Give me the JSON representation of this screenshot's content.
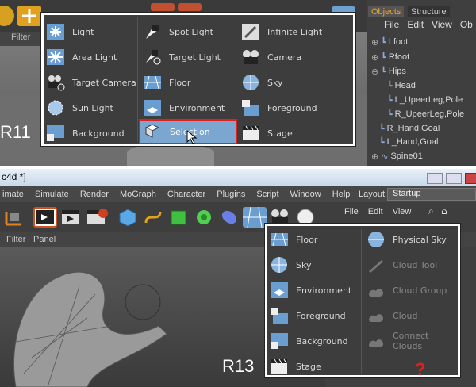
{
  "r11": {
    "label": "R11",
    "sub_toolbar": "Filter",
    "objects_panel": {
      "tabs": [
        "Objects",
        "Structure"
      ],
      "menu": [
        "File",
        "Edit",
        "View",
        "Ob"
      ],
      "tree": [
        "Lfoot",
        "Rfoot",
        "Hips",
        "Head",
        "L_UpeerLeg,Pole",
        "R_UpeerLeg,Pole",
        "R_Hand,Goal",
        "L_Hand,Goal",
        "Spine01"
      ]
    },
    "menu": [
      [
        "Light",
        "Spot Light",
        "Infinite Light"
      ],
      [
        "Area Light",
        "Target Light",
        "Camera"
      ],
      [
        "Target Camera",
        "Floor",
        "Sky"
      ],
      [
        "Sun Light",
        "Environment",
        "Foreground"
      ],
      [
        "Background",
        "Selection",
        "Stage"
      ]
    ],
    "highlighted": "Selection"
  },
  "r13": {
    "label": "R13",
    "title": "c4d *]",
    "menubar": [
      "imate",
      "Simulate",
      "Render",
      "MoGraph",
      "Character",
      "Plugins",
      "Script",
      "Window",
      "Help"
    ],
    "layout_label": "Layout:",
    "layout_value": "Startup",
    "sub_toolbar": [
      "Filter",
      "Panel"
    ],
    "obj_menu": [
      "File",
      "Edit",
      "View"
    ],
    "menu_left": [
      "Floor",
      "Sky",
      "Environment",
      "Foreground",
      "Background",
      "Stage"
    ],
    "menu_right": [
      "Physical Sky",
      "Cloud Tool",
      "Cloud Group",
      "Cloud",
      "Connect Clouds"
    ],
    "question_mark": "?"
  },
  "colors": {
    "highlight_border": "#e02020",
    "highlight_fill": "#7aa6cf",
    "question_mark": "#e02020"
  }
}
